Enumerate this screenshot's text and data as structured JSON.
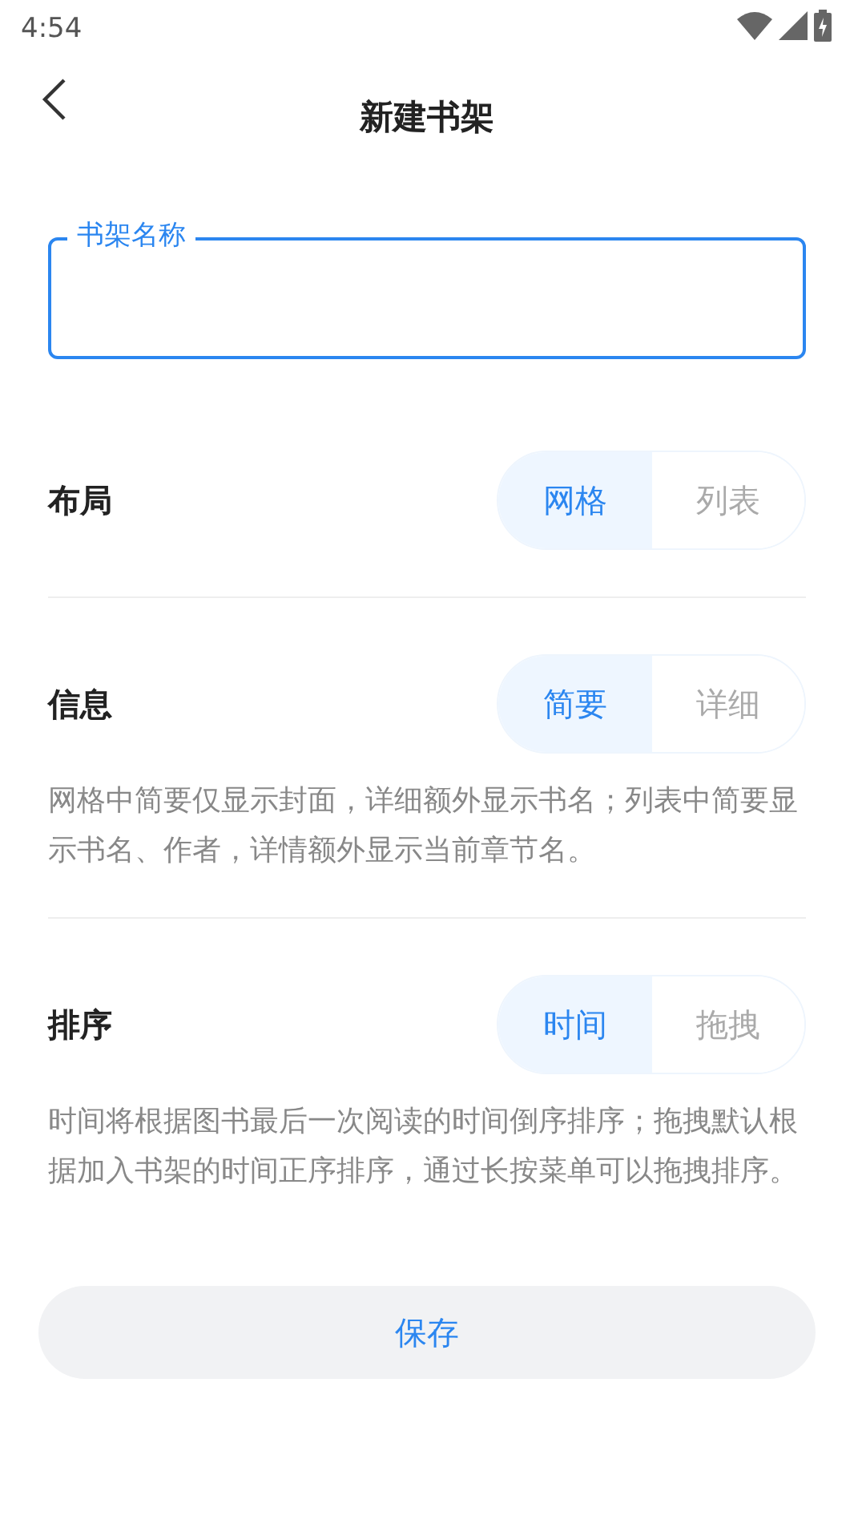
{
  "status_bar": {
    "time": "4:54"
  },
  "header": {
    "title": "新建书架"
  },
  "name_field": {
    "label": "书架名称"
  },
  "settings": [
    {
      "label": "布局",
      "options": [
        {
          "label": "网格",
          "selected": true
        },
        {
          "label": "列表",
          "selected": false
        }
      ]
    },
    {
      "label": "信息",
      "options": [
        {
          "label": "简要",
          "selected": true
        },
        {
          "label": "详细",
          "selected": false
        }
      ],
      "note": "网格中简要仅显示封面，详细额外显示书名；列表中简要显示书名、作者，详情额外显示当前章节名。"
    },
    {
      "label": "排序",
      "options": [
        {
          "label": "时间",
          "selected": true
        },
        {
          "label": "拖拽",
          "selected": false
        }
      ],
      "note": "时间将根据图书最后一次阅读的时间倒序排序；拖拽默认根据加入书架的时间正序排序，通过长按菜单可以拖拽排序。"
    }
  ],
  "save_button": {
    "label": "保存"
  }
}
